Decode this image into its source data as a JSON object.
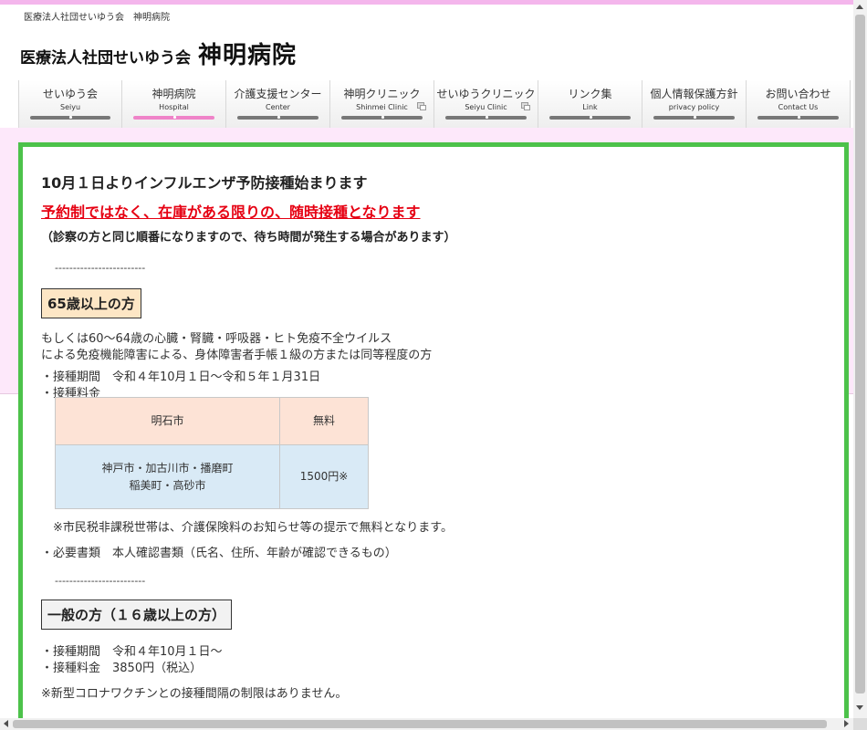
{
  "header": {
    "small_text": "医療法人社団せいゆう会　神明病院",
    "logo_small": "医療法人社団せいゆう会",
    "logo_big": "神明病院"
  },
  "nav": {
    "items": [
      {
        "label": "せいゆう会",
        "sub": "Seiyu",
        "active": false,
        "external": false
      },
      {
        "label": "神明病院",
        "sub": "Hospital",
        "active": true,
        "external": false
      },
      {
        "label": "介護支援センター",
        "sub": "Center",
        "active": false,
        "external": false
      },
      {
        "label": "神明クリニック",
        "sub": "Shinmei Clinic",
        "active": false,
        "external": true
      },
      {
        "label": "せいゆうクリニック",
        "sub": "Seiyu Clinic",
        "active": false,
        "external": true
      },
      {
        "label": "リンク集",
        "sub": "Link",
        "active": false,
        "external": false
      },
      {
        "label": "個人情報保護方針",
        "sub": "privacy  policy",
        "active": false,
        "external": false
      },
      {
        "label": "お問い合わせ",
        "sub": "Contact Us",
        "active": false,
        "external": false
      }
    ]
  },
  "content": {
    "title": "10月１日よりインフルエンザ予防接種始まります",
    "red_note": "予約制ではなく、在庫がある限りの、随時接種となります",
    "paren_note": "（診察の方と同じ順番になりますので、待ち時間が発生する場合があります）",
    "divider": "-------------------------",
    "senior": {
      "heading": "65歳以上の方",
      "line1": "もしくは60～64歳の心臓・腎臓・呼吸器・ヒト免疫不全ウイルス",
      "line2": "による免疫機能障害による、身体障害者手帳１級の方または同等程度の方",
      "period": "・接種期間　令和４年10月１日～令和５年１月31日",
      "fee_label": "・接種料金",
      "fee_table": [
        {
          "area": "明石市",
          "fee": "無料"
        },
        {
          "area_line1": "神戸市・加古川市・播磨町",
          "area_line2": "稲美町・高砂市",
          "fee": "1500円※"
        }
      ],
      "note": "※市民税非課税世帯は、介護保険料のお知らせ等の提示で無料となります。",
      "documents": "・必要書類　本人確認書類（氏名、住所、年齢が確認できるもの）"
    },
    "general": {
      "heading": "一般の方（１６歳以上の方）",
      "period": "・接種期間　令和４年10月１日～",
      "fee": "・接種料金　3850円（税込）",
      "covid_note": "※新型コロナワクチンとの接種間隔の制限はありません。"
    }
  },
  "colors": {
    "accent_pink": "#ef83c8",
    "green_border": "#4cc24a",
    "red_text": "#e60012"
  }
}
